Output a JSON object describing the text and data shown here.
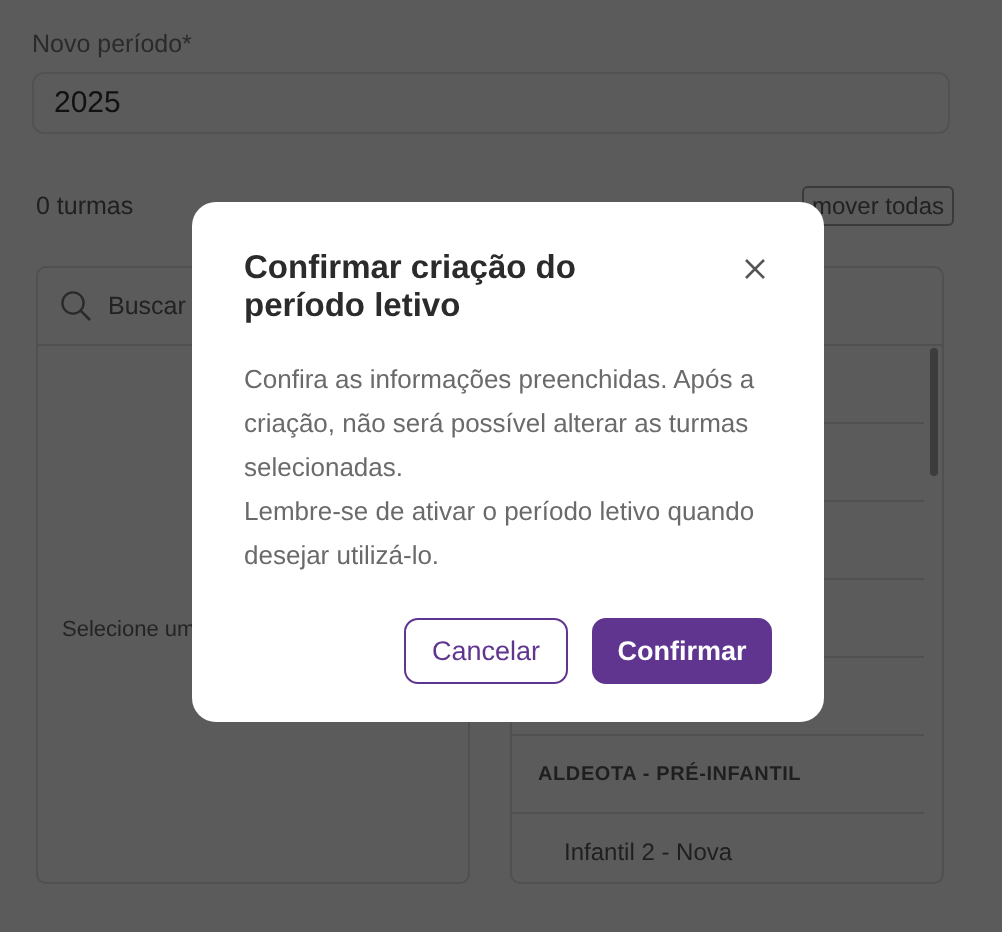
{
  "form": {
    "label": "Novo período*",
    "value": "2025"
  },
  "selection_bar": {
    "count": "0 turmas",
    "remove_button": "mover todas"
  },
  "available_panel": {
    "search_placeholder": "Buscar",
    "empty_message": "Selecione um"
  },
  "selected_panel": {
    "rows": [
      {
        "kind": "blank"
      },
      {
        "kind": "blank"
      },
      {
        "kind": "blank"
      },
      {
        "kind": "blank"
      },
      {
        "kind": "blank"
      },
      {
        "kind": "group",
        "text": "ALDEOTA - PRÉ-INFANTIL"
      },
      {
        "kind": "item",
        "text": "Infantil 2 - Nova"
      }
    ]
  },
  "dialog": {
    "title": "Confirmar criação do período letivo",
    "body": [
      "Confira as informações preenchidas. Após a criação, não será possível alterar as turmas selecionadas.",
      "Lembre-se de ativar o período letivo quando desejar utilizá-lo."
    ],
    "buttons": [
      {
        "label": "Cancelar",
        "kind": "secondary"
      },
      {
        "label": "Confirmar",
        "kind": "primary"
      }
    ]
  }
}
